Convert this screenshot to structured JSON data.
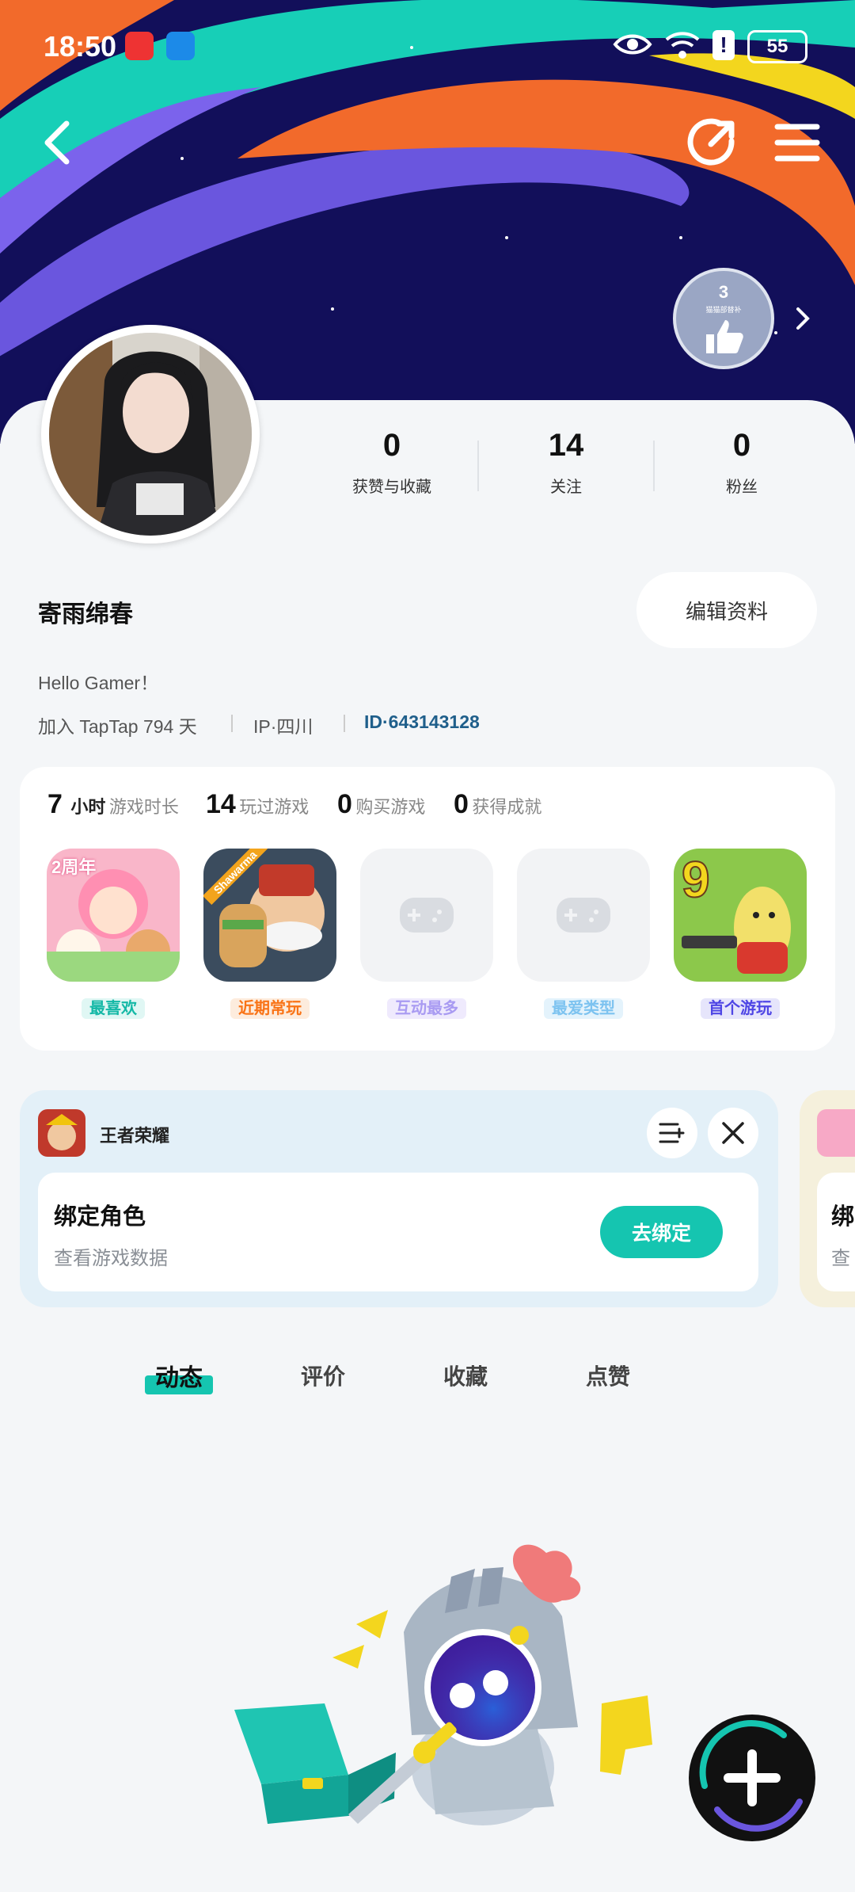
{
  "status_bar": {
    "time": "18:50",
    "battery": "55"
  },
  "header": {
    "back_icon": "back-arrow-icon",
    "share_icon": "share-icon",
    "menu_icon": "menu-icon",
    "badge_count": "3",
    "badge_text": "猫猫部替补"
  },
  "profile": {
    "name": "寄雨绵春",
    "edit_label": "编辑资料",
    "bio": "Hello Gamer！",
    "joined": "加入 TapTap 794 天",
    "ip": "IP·四川",
    "id": "ID·643143128",
    "stats": [
      {
        "value": "0",
        "label": "获赞与收藏"
      },
      {
        "value": "14",
        "label": "关注"
      },
      {
        "value": "0",
        "label": "粉丝"
      }
    ]
  },
  "game_stats": {
    "hours_value": "7",
    "hours_unit": "小时",
    "hours_label": "游戏时长",
    "played_value": "14",
    "played_label": "玩过游戏",
    "bought_value": "0",
    "bought_label": "购买游戏",
    "achievements_value": "0",
    "achievements_label": "获得成就",
    "tiles": [
      {
        "tag": "最喜欢",
        "tag_color": "#14b8a6",
        "tag_bg": "#e0f7f4",
        "art": "game-art-icon",
        "anniv": "2周年"
      },
      {
        "tag": "近期常玩",
        "tag_color": "#f97316",
        "tag_bg": "#fdecdd",
        "art": "game-art-icon",
        "banner": "Shawarma"
      },
      {
        "tag": "互动最多",
        "tag_color": "#a99bf2",
        "tag_bg": "#efeafd",
        "art": "controller-icon"
      },
      {
        "tag": "最爱类型",
        "tag_color": "#7dc3f0",
        "tag_bg": "#e4f3fc",
        "art": "controller-icon"
      },
      {
        "tag": "首个游玩",
        "tag_color": "#4f46e5",
        "tag_bg": "#e6e5fb",
        "art": "game-art-icon",
        "big_num": "9"
      }
    ]
  },
  "bind_card": {
    "game_name": "王者荣耀",
    "title": "绑定角色",
    "subtitle": "查看游戏数据",
    "button": "去绑定",
    "peek_title": "绑",
    "peek_sub": "查"
  },
  "tabs": [
    {
      "label": "动态",
      "active": true
    },
    {
      "label": "评价",
      "active": false
    },
    {
      "label": "收藏",
      "active": false
    },
    {
      "label": "点赞",
      "active": false
    }
  ],
  "colors": {
    "accent": "#15c5b0",
    "banner": "#120f5a",
    "id_link": "#1f5f8b"
  }
}
